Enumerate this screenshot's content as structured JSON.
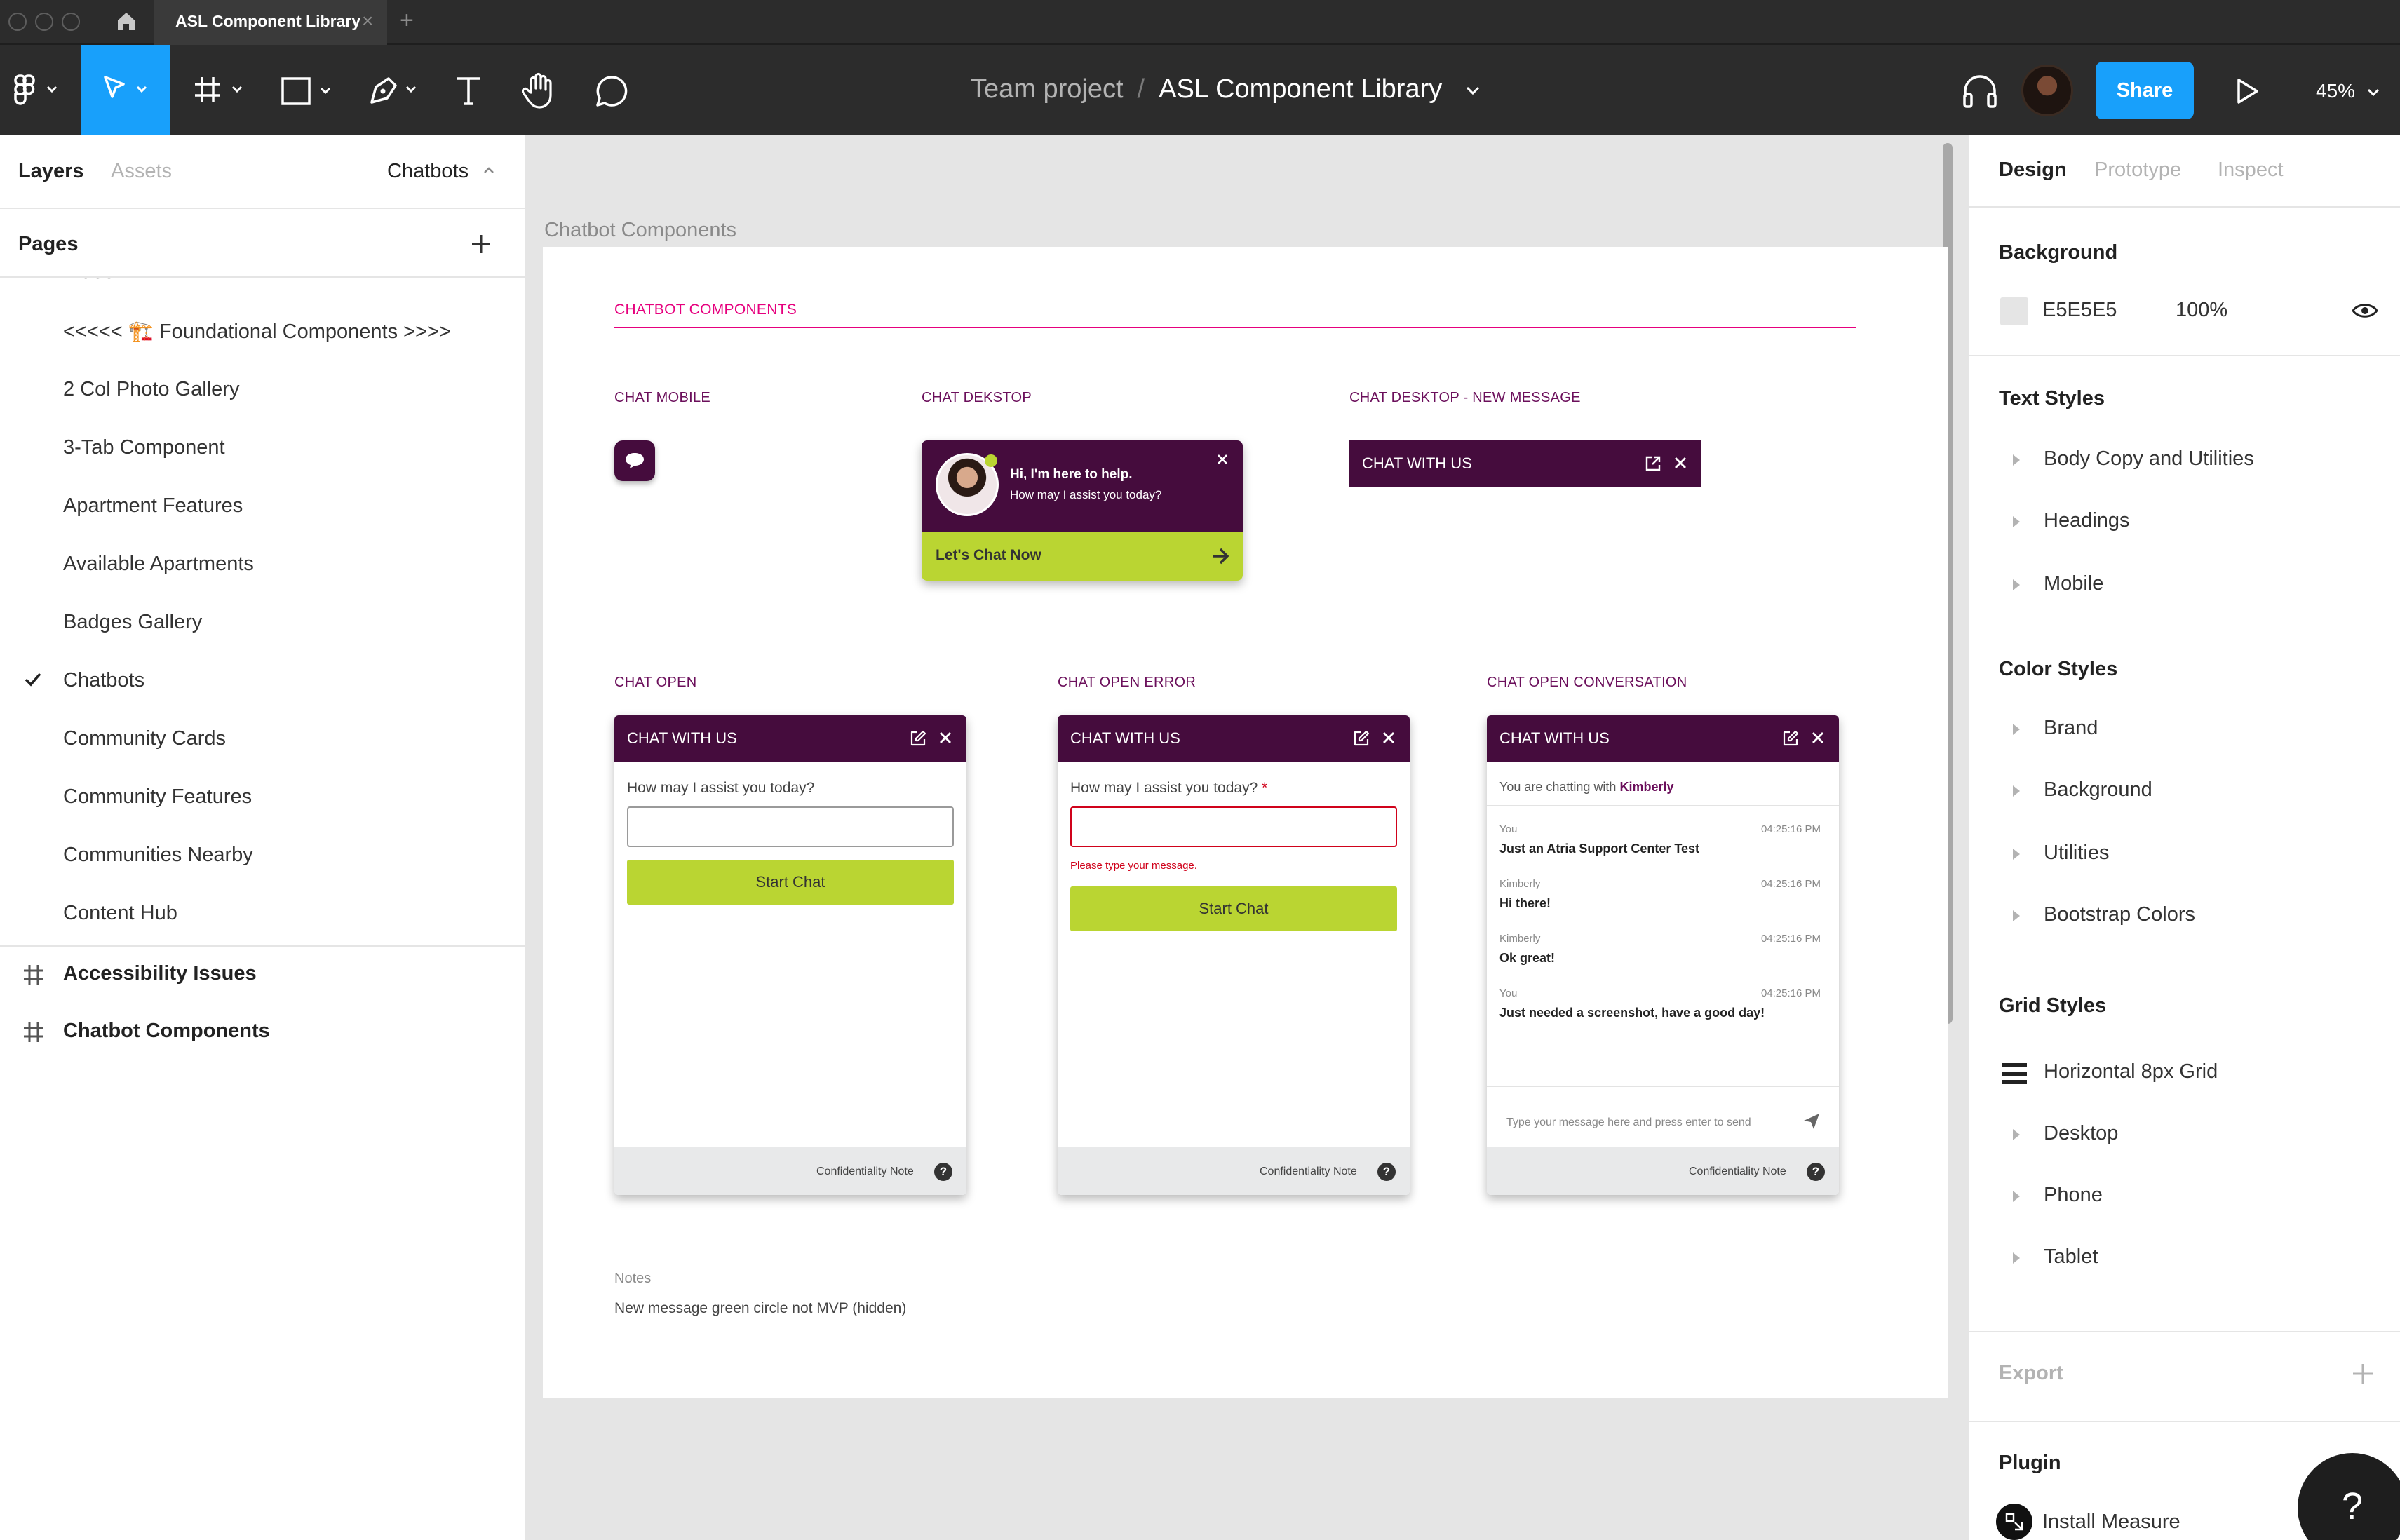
{
  "tabs": {
    "file_title": "ASL Component Library",
    "add_tab": "+"
  },
  "toolbar": {
    "project": "Team project",
    "separator": "/",
    "file": "ASL Component Library",
    "share": "Share",
    "zoom": "45%"
  },
  "left_panel": {
    "tab_layers": "Layers",
    "tab_assets": "Assets",
    "page_selector": "Chatbots",
    "pages_header": "Pages",
    "pages": [
      "Video",
      "<<<<< 🏗️ Foundational Components >>>>",
      "2 Col Photo Gallery",
      "3-Tab Component",
      "Apartment Features",
      "Available Apartments",
      "Badges Gallery",
      "Chatbots",
      "Community Cards",
      "Community Features",
      "Communities Nearby",
      "Content Hub"
    ],
    "active_page": "Chatbots",
    "frames": [
      "Accessibility Issues",
      "Chatbot Components"
    ]
  },
  "canvas": {
    "frame_label": "Chatbot Components",
    "header": "CHATBOT COMPONENTS",
    "sections": {
      "chat_mobile": "CHAT MOBILE",
      "chat_desktop": "CHAT DEKSTOP",
      "chat_desktop_new": "CHAT DESKTOP - NEW MESSAGE",
      "chat_open": "CHAT OPEN",
      "chat_open_error": "CHAT OPEN ERROR",
      "chat_open_conversation": "CHAT OPEN CONVERSATION"
    },
    "desktop_widget": {
      "line1": "Hi, I'm here to help.",
      "line2": "How may I assist you today?",
      "cta": "Let's Chat Now"
    },
    "chat_title": "CHAT WITH US",
    "prompt": "How may I assist you today?",
    "required_mark": "*",
    "error_message": "Please type your message.",
    "start_chat": "Start Chat",
    "confidentiality": "Confidentiality Note",
    "help_glyph": "?",
    "conversation": {
      "chatting_prefix": "You are chatting with",
      "agent": "Kimberly",
      "messages": [
        {
          "who": "You",
          "time": "04:25:16 PM",
          "text": "Just an Atria Support Center Test"
        },
        {
          "who": "Kimberly",
          "time": "04:25:16 PM",
          "text": "Hi there!"
        },
        {
          "who": "Kimberly",
          "time": "04:25:16 PM",
          "text": "Ok great!"
        },
        {
          "who": "You",
          "time": "04:25:16 PM",
          "text": "Just needed a screenshot, have a good day!"
        }
      ],
      "input_placeholder": "Type your message here and press enter to send"
    },
    "notes_label": "Notes",
    "notes_text": "New message green circle not MVP (hidden)"
  },
  "right_panel": {
    "tab_design": "Design",
    "tab_prototype": "Prototype",
    "tab_inspect": "Inspect",
    "background_header": "Background",
    "background_hex": "E5E5E5",
    "background_opacity": "100%",
    "text_styles_header": "Text Styles",
    "text_styles": [
      "Body Copy and Utilities",
      "Headings",
      "Mobile"
    ],
    "color_styles_header": "Color Styles",
    "color_styles": [
      "Brand",
      "Background",
      "Utilities",
      "Bootstrap Colors"
    ],
    "grid_styles_header": "Grid Styles",
    "grid_styles": [
      "Horizontal 8px Grid",
      "Desktop",
      "Phone",
      "Tablet"
    ],
    "export_header": "Export",
    "plugin_header": "Plugin",
    "plugin_item": "Install Measure",
    "help": "?"
  },
  "colors": {
    "figma_blue": "#18A0FB",
    "chat_plum": "#450C3D",
    "chat_green": "#BAD532",
    "accent_pink": "#E6007E",
    "error_red": "#D0021B",
    "canvas_bg": "#E5E5E5"
  }
}
